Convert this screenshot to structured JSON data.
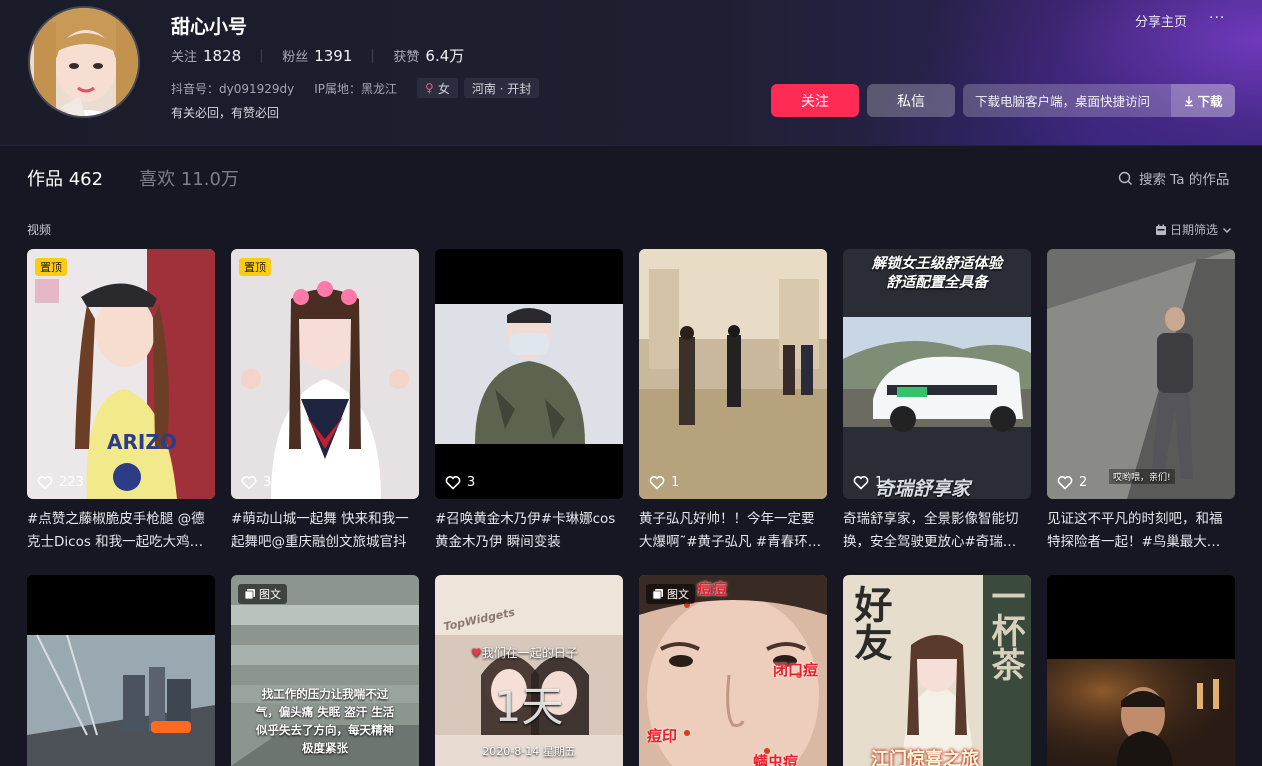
{
  "profile": {
    "nickname": "甜心小号",
    "stats": [
      {
        "label": "关注",
        "value": "1828"
      },
      {
        "label": "粉丝",
        "value": "1391"
      },
      {
        "label": "获赞",
        "value": "6.4万"
      }
    ],
    "douyin_id": "抖音号：dy091929dy",
    "ip_location": "IP属地：黑龙江",
    "gender_symbol": "♀",
    "gender": "女",
    "location_tag": "河南 · 开封",
    "signature": "有关必回，有赞必回"
  },
  "header_actions": {
    "share": "分享主页",
    "more": "···",
    "follow": "关注",
    "message": "私信",
    "download_prompt": "下载电脑客户端，桌面快捷访问",
    "download": "下载"
  },
  "tabs": [
    {
      "label": "作品",
      "count": "462"
    },
    {
      "label": "喜欢",
      "count": "11.0万"
    }
  ],
  "search_works": "搜索 Ta 的作品",
  "section_label": "视频",
  "date_filter": "日期筛选",
  "pinned_label": "置顶",
  "image_post_label": "图文",
  "videos_row1": [
    {
      "likes": "223",
      "title": "#点赞之藤椒脆皮手枪腿 @德克士Dicos 和我一起吃大鸡…"
    },
    {
      "likes": "311",
      "title": "#萌动山城一起舞 快来和我一起舞吧@重庆融创文旅城官抖"
    },
    {
      "likes": "3",
      "title": "#召唤黄金木乃伊#卡琳娜cos 黄金木乃伊 瞬间变装"
    },
    {
      "likes": "1",
      "title": "黄子弘凡好帅！！今年一定要大爆啊˜#黄子弘凡 #青春环…"
    },
    {
      "likes": "1",
      "title": "奇瑞舒享家，全景影像智能切换，安全驾驶更放心#奇瑞…"
    },
    {
      "likes": "2",
      "title": "见证这不平凡的时刻吧，和福特探险者一起！#鸟巢最大…"
    }
  ],
  "thumb_text": {
    "car_top1": "解锁女王级舒适体验",
    "car_top2": "舒适配置全具备",
    "car_bottom": "奇瑞舒享家",
    "explorer_caption": "哎哟喂，亲们!",
    "stress_lines": [
      "找工作的压力让我喘不过",
      "气，偏头痛 失眠 盗汗 生活",
      "似乎失去了方向，每天精神",
      "极度紧张"
    ],
    "days_header": "我们在一起的日子",
    "days_count": "1天",
    "days_date": "2020-8-14 星期五",
    "days_brand": "TopWidgets",
    "acne1": "痘痘",
    "acne2": "闭口痘",
    "acne3": "痘印",
    "acne4": "螨虫痘",
    "tea_left": "好友",
    "tea_right": "一杯茶",
    "tea_bottom": "江门惊喜之旅"
  }
}
